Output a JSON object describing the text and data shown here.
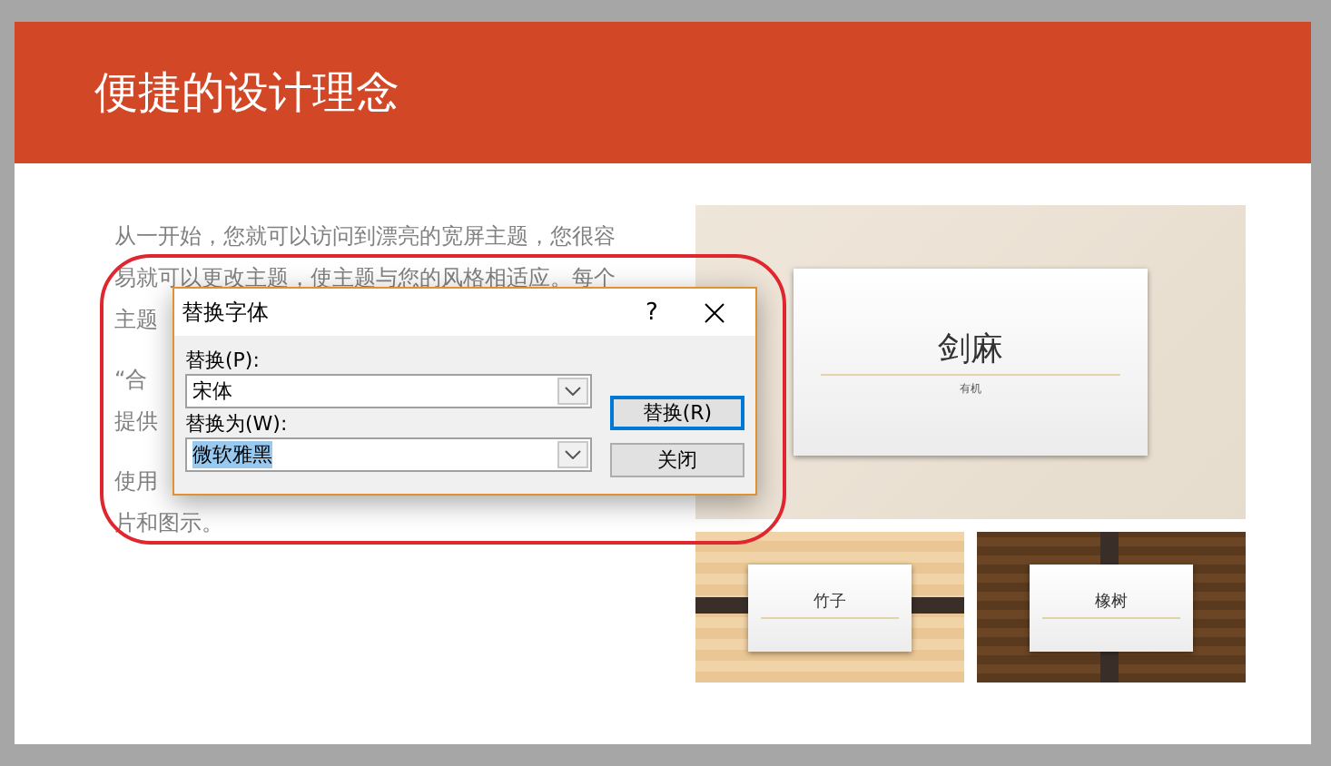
{
  "slide": {
    "title": "便捷的设计理念",
    "paragraphs": [
      [
        "从一开始，您就可以访问到漂亮的宽屏主题，您很容",
        "易就可以更改主题，使主题与您的风格相适应。每个",
        "主题"
      ],
      [
        "“合",
        "提供"
      ],
      [
        "使用",
        "片和图示。"
      ]
    ],
    "images": [
      {
        "kind": "linen",
        "title": "剑麻",
        "subtitle": "有机"
      },
      {
        "kind": "bamboo",
        "title": "竹子"
      },
      {
        "kind": "oak",
        "title": "橡树"
      }
    ]
  },
  "dialog": {
    "title": "替换字体",
    "help": "?",
    "fields": [
      {
        "label": "替换(P):",
        "value": "宋体",
        "text_selected": false
      },
      {
        "label": "替换为(W):",
        "value": "微软雅黑",
        "text_selected": true
      }
    ],
    "buttons": [
      {
        "label": "替换(R)",
        "default": true
      },
      {
        "label": "关闭",
        "default": false
      }
    ]
  }
}
